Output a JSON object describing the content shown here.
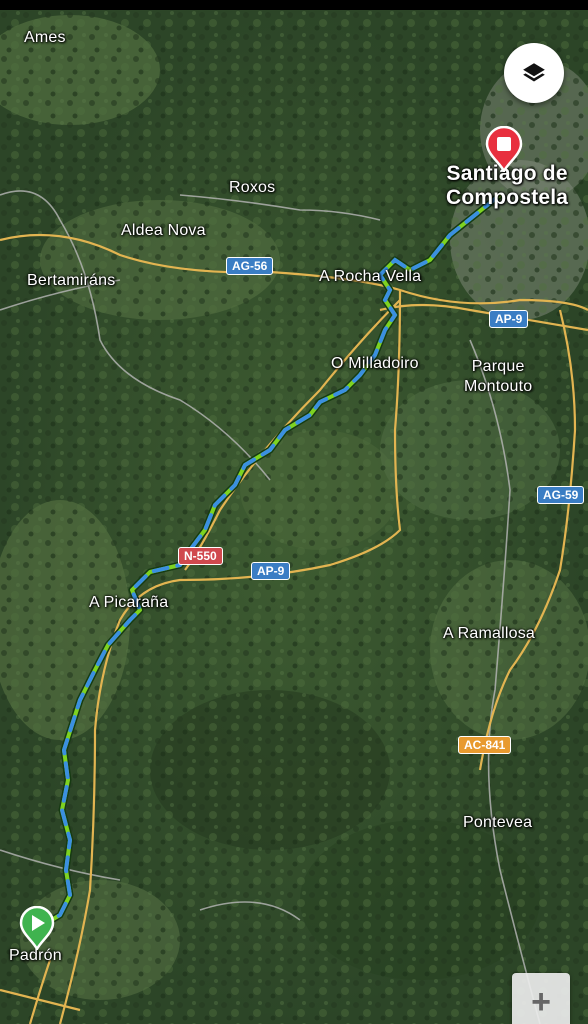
{
  "map": {
    "places": {
      "ames": "Ames",
      "roxos": "Roxos",
      "aldea_nova": "Aldea Nova",
      "bertamirans": "Bertamiráns",
      "a_rocha_vella": "A Rocha Vella",
      "o_milladoiro": "O Milladoiro",
      "parque_montouto": "Parque\nMontouto",
      "a_picarana": "A Picaraña",
      "a_ramallosa": "A Ramallosa",
      "pontevea": "Pontevea",
      "padron": "Padrón",
      "santiago_line1": "Santiago de",
      "santiago_line2": "Compostela"
    },
    "road_shields": {
      "ag56": "AG-56",
      "ap9_north": "AP-9",
      "ag59": "AG-59",
      "n550": "N-550",
      "ap9_south": "AP-9",
      "ac841": "AC-841"
    },
    "colors": {
      "route_green": "#7ed321",
      "route_blue": "#3b8fe0",
      "road_yellow": "#e2b451",
      "start_marker": "#3fb34f",
      "end_marker": "#e8303f"
    }
  },
  "controls": {
    "layers_icon": "layers-icon",
    "zoom_in_label": "+"
  }
}
